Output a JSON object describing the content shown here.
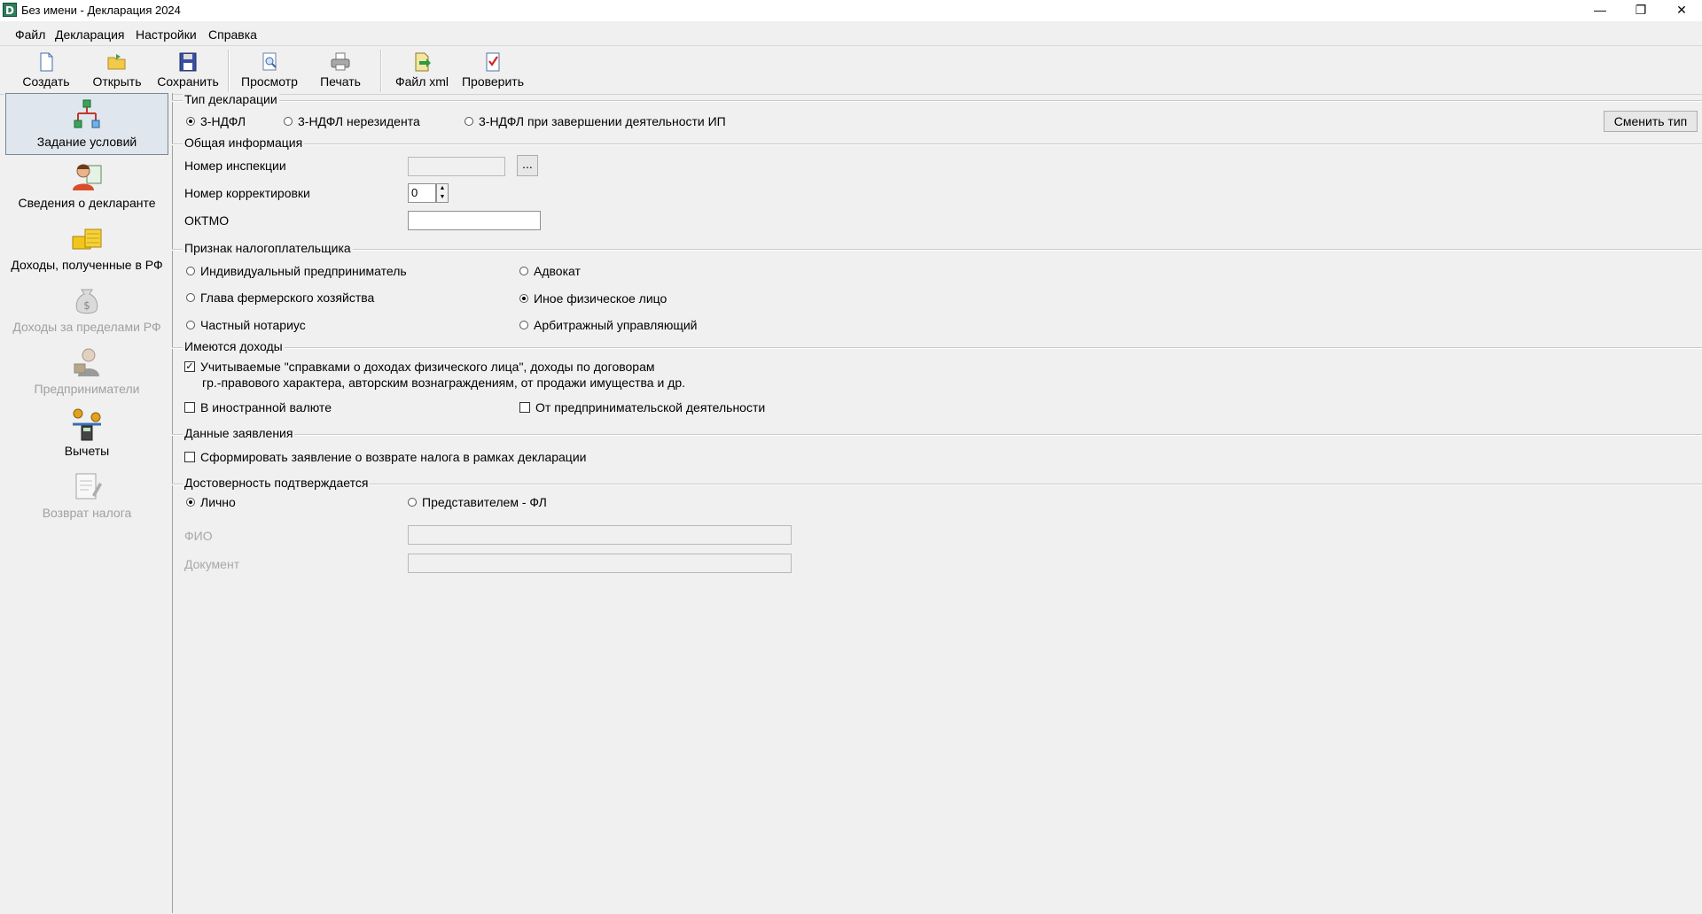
{
  "window": {
    "title": "Без имени - Декларация 2024",
    "app_icon_glyph": "D",
    "controls": {
      "minimize": "—",
      "maximize": "❐",
      "close": "✕"
    }
  },
  "menu": [
    "Файл",
    "Декларация",
    "Настройки",
    "Справка"
  ],
  "toolbar": [
    {
      "label": "Создать",
      "icon": "new-file-icon"
    },
    {
      "label": "Открыть",
      "icon": "open-folder-icon"
    },
    {
      "label": "Сохранить",
      "icon": "save-disk-icon"
    },
    {
      "label": "Просмотр",
      "icon": "preview-magnifier-icon"
    },
    {
      "label": "Печать",
      "icon": "printer-icon"
    },
    {
      "label": "Файл xml",
      "icon": "xml-export-icon"
    },
    {
      "label": "Проверить",
      "icon": "check-document-icon"
    }
  ],
  "sidebar": [
    {
      "label": "Задание условий",
      "icon": "conditions-tree-icon",
      "selected": true,
      "enabled": true
    },
    {
      "label": "Сведения о декларанте",
      "icon": "person-card-icon",
      "selected": false,
      "enabled": true
    },
    {
      "label": "Доходы, полученные в РФ",
      "icon": "coins-stack-icon",
      "selected": false,
      "enabled": true
    },
    {
      "label": "Доходы за пределами РФ",
      "icon": "money-bag-icon",
      "selected": false,
      "enabled": false
    },
    {
      "label": "Предприниматели",
      "icon": "businessman-icon",
      "selected": false,
      "enabled": false
    },
    {
      "label": "Вычеты",
      "icon": "calculator-coins-icon",
      "selected": false,
      "enabled": true
    },
    {
      "label": "Возврат налога",
      "icon": "document-pen-icon",
      "selected": false,
      "enabled": false
    }
  ],
  "declaration_type": {
    "title": "Тип декларации",
    "options": [
      "3-НДФЛ",
      "3-НДФЛ нерезидента",
      "3-НДФЛ при завершении деятельности ИП"
    ],
    "selected_index": 0,
    "change_button": "Сменить тип"
  },
  "general_info": {
    "title": "Общая информация",
    "inspection_label": "Номер инспекции",
    "inspection_value": "",
    "browse_button": "...",
    "correction_label": "Номер корректировки",
    "correction_value": "0",
    "oktmo_label": "ОКТМО",
    "oktmo_value": ""
  },
  "taxpayer_sign": {
    "title": "Признак налогоплательщика",
    "options": [
      "Индивидуальный предприниматель",
      "Адвокат",
      "Глава фермерского хозяйства",
      "Иное физическое лицо",
      "Частный нотариус",
      "Арбитражный управляющий"
    ],
    "selected": "Иное физическое лицо"
  },
  "incomes": {
    "title": "Имеются доходы",
    "certified_line1": "Учитываемые \"справками о доходах физического лица\", доходы по договорам",
    "certified_line2": "гр.-правового характера, авторским вознаграждениям, от продажи имущества и др.",
    "certified_checked": true,
    "foreign_currency": "В иностранной валюте",
    "foreign_currency_checked": false,
    "business": "От предпринимательской деятельности",
    "business_checked": false
  },
  "application": {
    "title": "Данные заявления",
    "refund_label": "Сформировать заявление о возврате налога в рамках декларации",
    "refund_checked": false
  },
  "reliability": {
    "title": "Достоверность подтверждается",
    "personal": "Лично",
    "representative": "Представителем - ФЛ",
    "selected": "Лично",
    "fio_label": "ФИО",
    "fio_value": "",
    "doc_label": "Документ",
    "doc_value": ""
  }
}
